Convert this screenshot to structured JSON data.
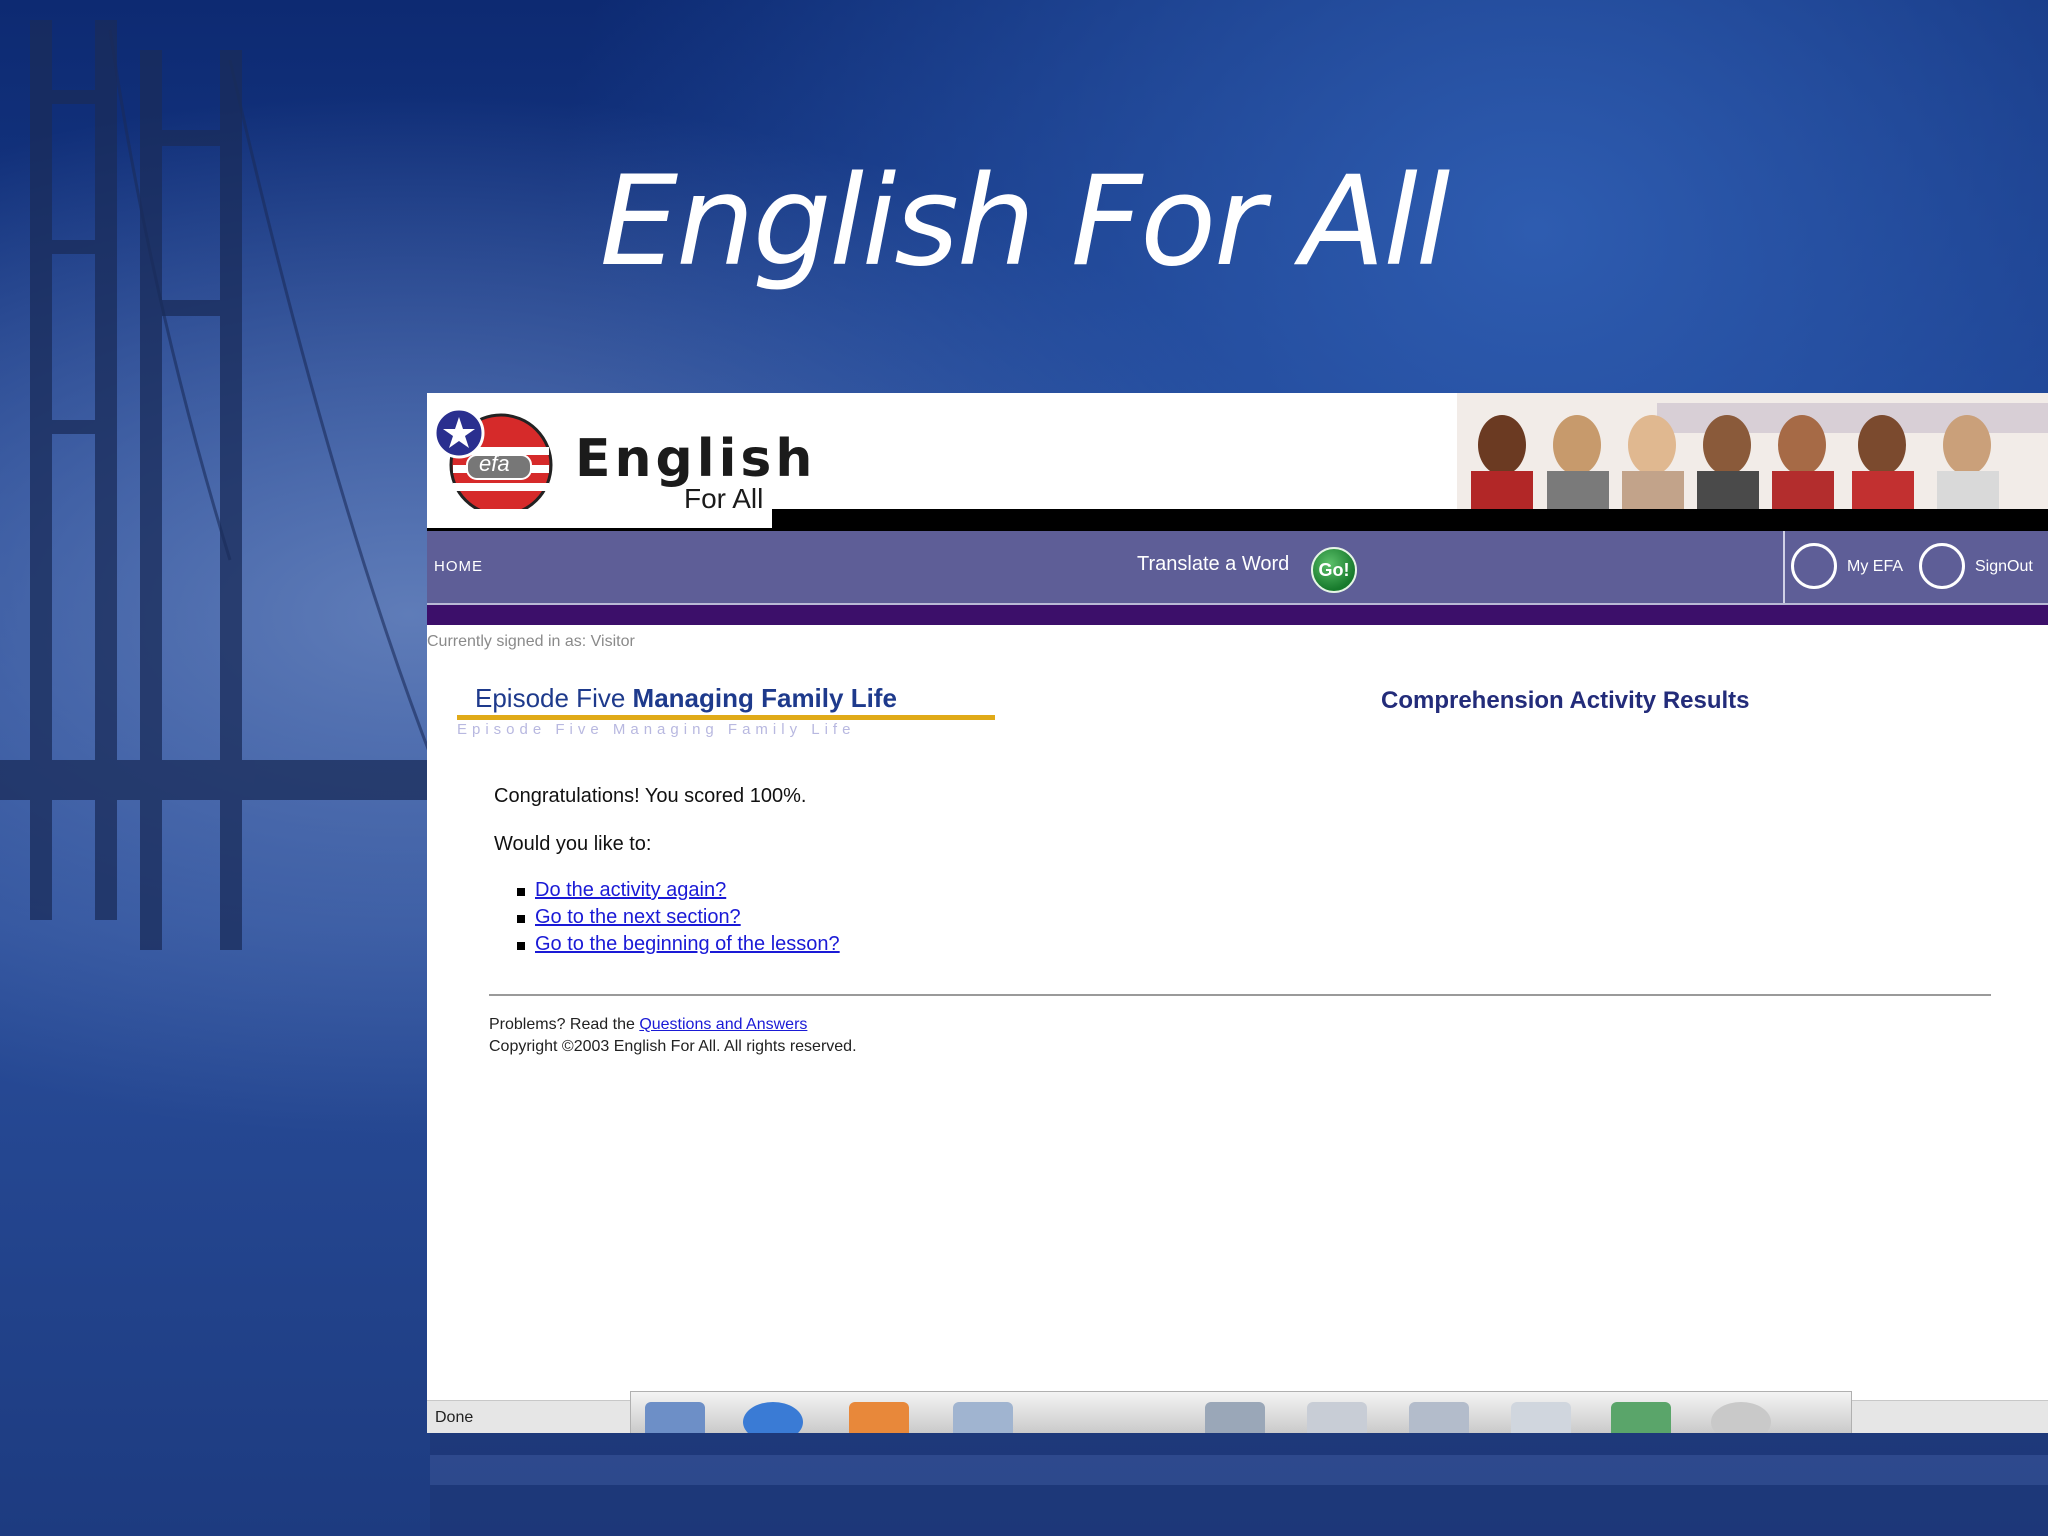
{
  "slide": {
    "title": "English For All"
  },
  "site": {
    "logo_abbr": "efa",
    "logo_word": "English",
    "logo_sub": "For All"
  },
  "nav": {
    "home": "HOME",
    "translate": "Translate a Word",
    "go": "Go!",
    "my_efa": "My EFA",
    "sign_out": "SignOut"
  },
  "signin_status": "Currently signed in as: Visitor",
  "episode": {
    "prefix": "Episode Five",
    "title": "Managing Family Life",
    "ghost": "Episode Five Managing Family Life"
  },
  "results_title": "Comprehension Activity Results",
  "content": {
    "congrats": "Congratulations! You scored 100%.",
    "would": "Would you like to:",
    "options": [
      "Do the activity again?",
      "Go to the next section?",
      "Go to the beginning of the lesson?"
    ]
  },
  "footer": {
    "problems_prefix": "Problems? Read the",
    "problems_link": "Questions and Answers",
    "copyright": "Copyright ©2003 English For All. All rights reserved."
  },
  "status": {
    "done": "Done"
  },
  "colors": {
    "navbar": "#5e5e97",
    "purple_bar": "#3c0f6a",
    "link": "#1a1ad6",
    "episode_underline": "#e0aa18"
  }
}
